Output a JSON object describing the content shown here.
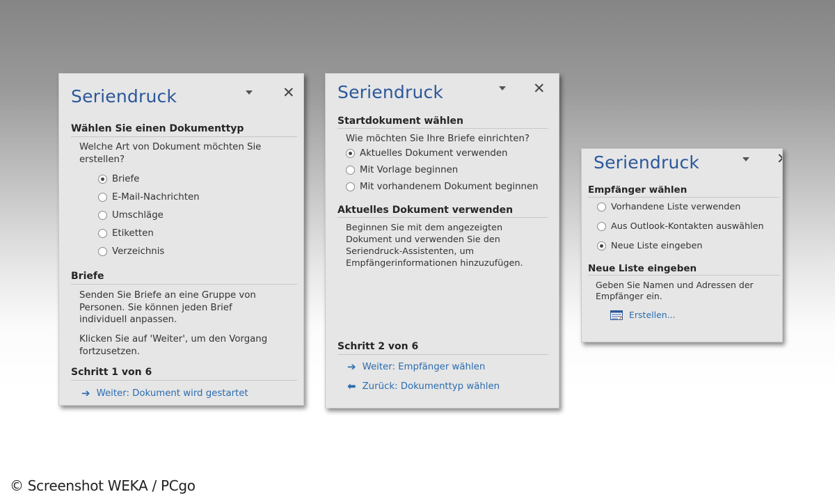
{
  "panel1": {
    "title": "Seriendruck",
    "section1": "Wählen Sie einen Dokumenttyp",
    "question": "Welche Art von Dokument möchten Sie erstellen?",
    "options": [
      "Briefe",
      "E-Mail-Nachrichten",
      "Umschläge",
      "Etiketten",
      "Verzeichnis"
    ],
    "selected_option": "Briefe",
    "section2": "Briefe",
    "desc1": "Senden Sie Briefe an eine Gruppe von Personen. Sie können jeden Brief individuell anpassen.",
    "desc2": "Klicken Sie auf 'Weiter', um den Vorgang fortzusetzen.",
    "step": "Schritt 1 von 6",
    "next_link": "Weiter: Dokument wird gestartet"
  },
  "panel2": {
    "title": "Seriendruck",
    "section1": "Startdokument wählen",
    "question": "Wie möchten Sie Ihre Briefe einrichten?",
    "options": [
      "Aktuelles Dokument verwenden",
      "Mit Vorlage beginnen",
      "Mit vorhandenem Dokument beginnen"
    ],
    "selected_option": "Aktuelles Dokument verwenden",
    "section2": "Aktuelles Dokument verwenden",
    "desc": "Beginnen Sie mit dem angezeigten Dokument und verwenden Sie den Seriendruck-Assistenten, um Empfängerinformationen hinzuzufügen.",
    "step": "Schritt 2 von 6",
    "next_link": "Weiter: Empfänger wählen",
    "back_link": "Zurück: Dokumenttyp wählen"
  },
  "panel3": {
    "title": "Seriendruck",
    "section1": "Empfänger wählen",
    "options": [
      "Vorhandene Liste verwenden",
      "Aus Outlook-Kontakten auswählen",
      "Neue Liste eingeben"
    ],
    "selected_option": "Neue Liste eingeben",
    "section2": "Neue Liste eingeben",
    "desc": "Geben Sie Namen und Adressen der Empfänger ein.",
    "create_link": "Erstellen..."
  },
  "watermark": "© Screenshot WEKA / PCgo",
  "colors": {
    "title_blue": "#2b579a",
    "link_blue": "#2b6cb0",
    "panel_bg": "#e6e6e6"
  }
}
